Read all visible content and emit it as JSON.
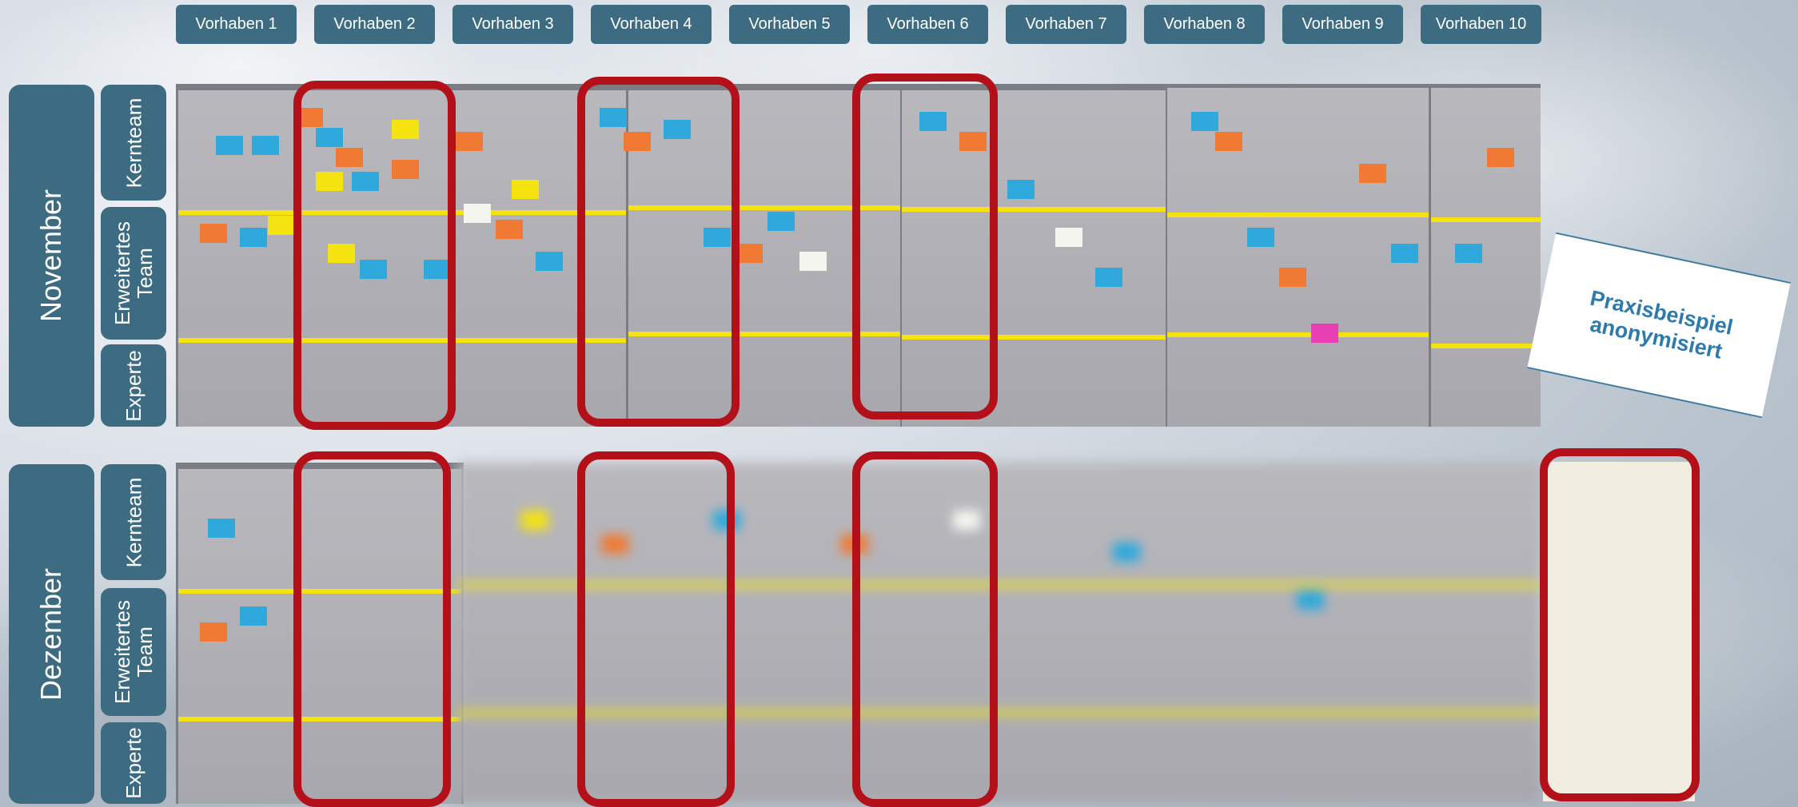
{
  "projects": [
    "Vorhaben 1",
    "Vorhaben 2",
    "Vorhaben 3",
    "Vorhaben 4",
    "Vorhaben 5",
    "Vorhaben 6",
    "Vorhaben 7",
    "Vorhaben 8",
    "Vorhaben 9",
    "Vorhaben 10"
  ],
  "months": {
    "november": "November",
    "dezember": "Dezember"
  },
  "roles": {
    "kernteam": "Kernteam",
    "erweitertes_team": "Erweitertes\nTeam",
    "experte": "Experte"
  },
  "stamp": {
    "text": "Praxisbeispiel\nanonymisiert"
  },
  "colors": {
    "label_bg": "#3d6c82",
    "highlight": "#b3101a",
    "stamp_text": "#2d7aad",
    "note_orange": "#f07a33",
    "note_blue": "#2fa9dc",
    "note_yellow": "#f4e311",
    "note_white": "#f5f5f0",
    "note_pink": "#e93fb5"
  }
}
